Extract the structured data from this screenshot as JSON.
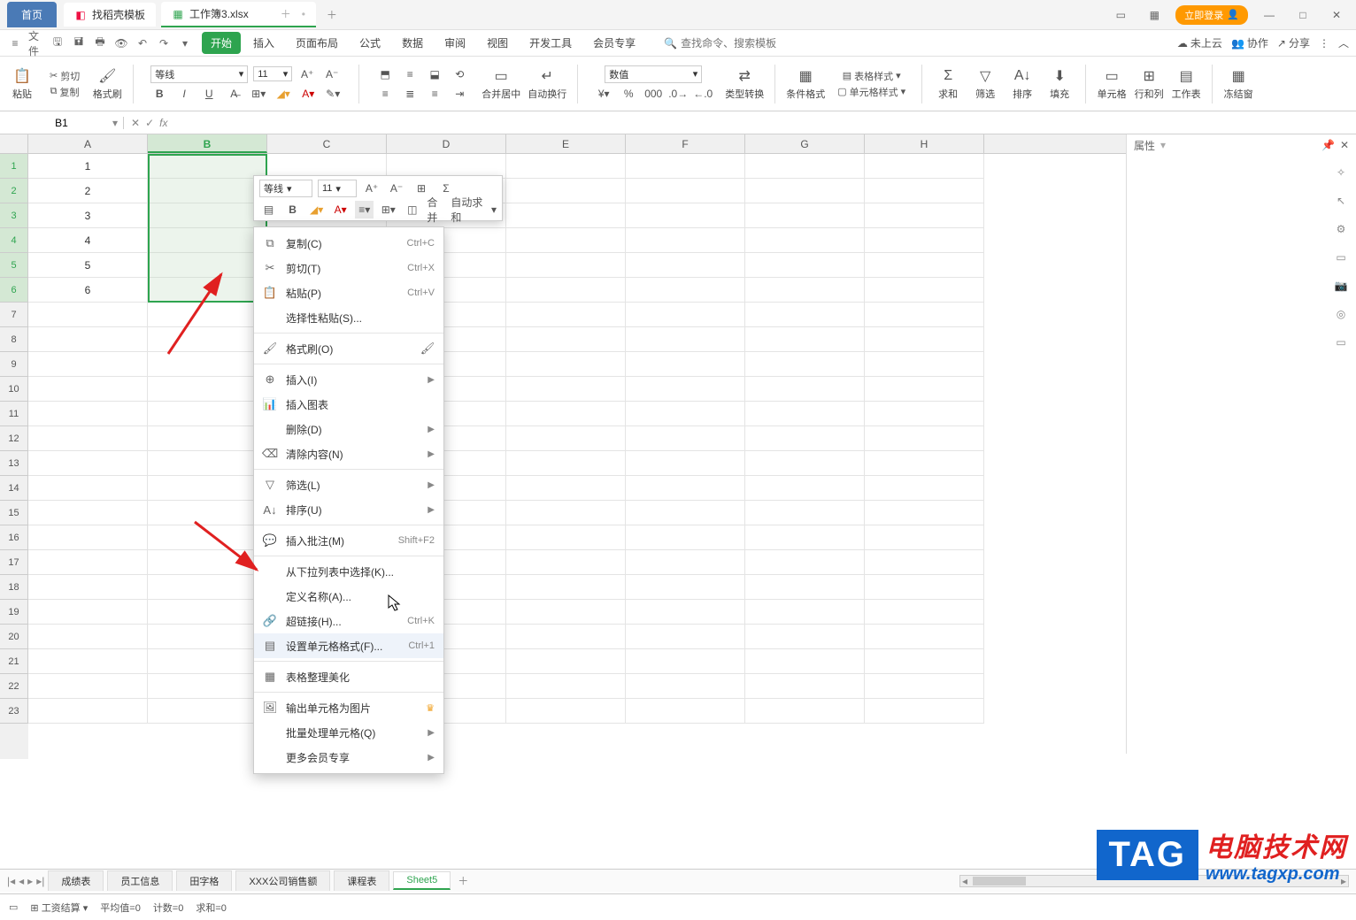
{
  "titlebar": {
    "home": "首页",
    "templates": "找稻壳模板",
    "workbook": "工作簿3.xlsx",
    "login": "立即登录"
  },
  "menubar": {
    "file": "文件",
    "tabs": [
      "开始",
      "插入",
      "页面布局",
      "公式",
      "数据",
      "审阅",
      "视图",
      "开发工具",
      "会员专享"
    ],
    "active": 0,
    "search_placeholder": "查找命令、搜索模板",
    "cloud": "未上云",
    "coop": "协作",
    "share": "分享"
  },
  "ribbon": {
    "paste": "粘贴",
    "cut": "剪切",
    "copy": "复制",
    "format_painter": "格式刷",
    "font_name": "等线",
    "font_size": "11",
    "merge": "合并居中",
    "wrap": "自动换行",
    "num_format": "数值",
    "type_convert": "类型转换",
    "cond_fmt": "条件格式",
    "table_fmt": "表格样式",
    "cell_style": "单元格样式",
    "sum": "求和",
    "filter": "筛选",
    "sort": "排序",
    "fill": "填充",
    "cells": "单元格",
    "rowcol": "行和列",
    "worksheet": "工作表",
    "freeze": "冻结窗"
  },
  "fbar": {
    "name": "B1"
  },
  "cols": [
    "A",
    "B",
    "C",
    "D",
    "E",
    "F",
    "G",
    "H"
  ],
  "rows_numbered": 23,
  "colA_values": [
    "1",
    "2",
    "3",
    "4",
    "5",
    "6"
  ],
  "selected_col_index": 1,
  "selected_rows": [
    1,
    2,
    3,
    4,
    5,
    6
  ],
  "minitoolbar": {
    "font_name": "等线",
    "font_size": "11",
    "merge": "合并",
    "autosum": "自动求和"
  },
  "context_menu": [
    {
      "type": "item",
      "icon": "copy",
      "label": "复制(C)",
      "shortcut": "Ctrl+C"
    },
    {
      "type": "item",
      "icon": "cut",
      "label": "剪切(T)",
      "shortcut": "Ctrl+X"
    },
    {
      "type": "item",
      "icon": "paste",
      "label": "粘贴(P)",
      "shortcut": "Ctrl+V"
    },
    {
      "type": "item",
      "icon": "",
      "label": "选择性粘贴(S)...",
      "shortcut": ""
    },
    {
      "type": "sep"
    },
    {
      "type": "item",
      "icon": "brush",
      "label": "格式刷(O)",
      "shortcut": "",
      "right_icon": "brush"
    },
    {
      "type": "sep"
    },
    {
      "type": "item",
      "icon": "insert",
      "label": "插入(I)",
      "sub": true
    },
    {
      "type": "item",
      "icon": "chart",
      "label": "插入图表",
      "shortcut": ""
    },
    {
      "type": "item",
      "icon": "",
      "label": "删除(D)",
      "sub": true
    },
    {
      "type": "item",
      "icon": "erase",
      "label": "清除内容(N)",
      "sub": true
    },
    {
      "type": "sep"
    },
    {
      "type": "item",
      "icon": "filter",
      "label": "筛选(L)",
      "sub": true
    },
    {
      "type": "item",
      "icon": "sort",
      "label": "排序(U)",
      "sub": true
    },
    {
      "type": "sep"
    },
    {
      "type": "item",
      "icon": "comment",
      "label": "插入批注(M)",
      "shortcut": "Shift+F2"
    },
    {
      "type": "sep"
    },
    {
      "type": "item",
      "icon": "",
      "label": "从下拉列表中选择(K)...",
      "shortcut": ""
    },
    {
      "type": "item",
      "icon": "",
      "label": "定义名称(A)...",
      "shortcut": ""
    },
    {
      "type": "item",
      "icon": "link",
      "label": "超链接(H)...",
      "shortcut": "Ctrl+K"
    },
    {
      "type": "item",
      "icon": "format",
      "label": "设置单元格格式(F)...",
      "shortcut": "Ctrl+1",
      "hover": true
    },
    {
      "type": "sep"
    },
    {
      "type": "item",
      "icon": "table",
      "label": "表格整理美化",
      "shortcut": ""
    },
    {
      "type": "sep"
    },
    {
      "type": "item",
      "icon": "image",
      "label": "输出单元格为图片",
      "vip": true
    },
    {
      "type": "item",
      "icon": "",
      "label": "批量处理单元格(Q)",
      "sub": true
    },
    {
      "type": "item",
      "icon": "",
      "label": "更多会员专享",
      "sub": true
    }
  ],
  "sheets": [
    "成绩表",
    "员工信息",
    "田字格",
    "XXX公司销售额",
    "课程表",
    "Sheet5"
  ],
  "active_sheet": 5,
  "statusbar": {
    "result": "工资结算",
    "avg": "平均值=0",
    "count": "计数=0",
    "sum": "求和=0"
  },
  "rightpane": {
    "title": "属性"
  },
  "watermark": {
    "tag": "TAG",
    "line1": "电脑技术网",
    "line2": "www.tagxp.com"
  }
}
